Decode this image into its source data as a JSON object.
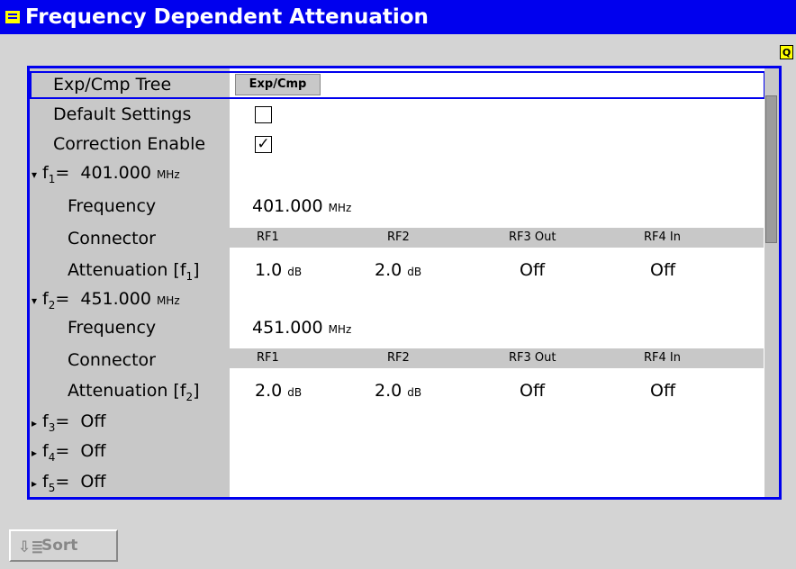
{
  "window": {
    "title": "Frequency Dependent Attenuation",
    "indicator": "Q"
  },
  "tree": {
    "label": "Exp/Cmp Tree",
    "button": "Exp/Cmp"
  },
  "default_settings": {
    "label": "Default Settings",
    "checked": false
  },
  "correction_enable": {
    "label": "Correction Enable",
    "checked": true,
    "check_mark": "✓"
  },
  "f1": {
    "name": "f",
    "sub": "1",
    "eq": "=",
    "value": "401.000",
    "unit": "MHz",
    "frequency_label": "Frequency",
    "frequency_value": "401.000",
    "frequency_unit": "MHz",
    "connector_label": "Connector",
    "attenuation_label": "Attenuation [f",
    "attenuation_sub": "1",
    "attenuation_close": "]",
    "connectors": [
      "RF1",
      "RF2",
      "RF3 Out",
      "RF4 In"
    ],
    "attenuations": [
      {
        "value": "1.0",
        "unit": "dB"
      },
      {
        "value": "2.0",
        "unit": "dB"
      },
      {
        "value": "Off",
        "unit": ""
      },
      {
        "value": "Off",
        "unit": ""
      }
    ]
  },
  "f2": {
    "name": "f",
    "sub": "2",
    "eq": "=",
    "value": "451.000",
    "unit": "MHz",
    "frequency_label": "Frequency",
    "frequency_value": "451.000",
    "frequency_unit": "MHz",
    "connector_label": "Connector",
    "attenuation_label": "Attenuation [f",
    "attenuation_sub": "2",
    "attenuation_close": "]",
    "connectors": [
      "RF1",
      "RF2",
      "RF3 Out",
      "RF4 In"
    ],
    "attenuations": [
      {
        "value": "2.0",
        "unit": "dB"
      },
      {
        "value": "2.0",
        "unit": "dB"
      },
      {
        "value": "Off",
        "unit": ""
      },
      {
        "value": "Off",
        "unit": ""
      }
    ]
  },
  "f3": {
    "name": "f",
    "sub": "3",
    "eq": "=",
    "value": "Off"
  },
  "f4": {
    "name": "f",
    "sub": "4",
    "eq": "=",
    "value": "Off"
  },
  "f5": {
    "name": "f",
    "sub": "5",
    "eq": "=",
    "value": "Off"
  },
  "sort_button": {
    "label": "Sort",
    "icon": "sort-icon"
  },
  "colors": {
    "title_bar": "#0000ee",
    "frame_border": "#0000ee",
    "indicator": "#ffff00"
  }
}
